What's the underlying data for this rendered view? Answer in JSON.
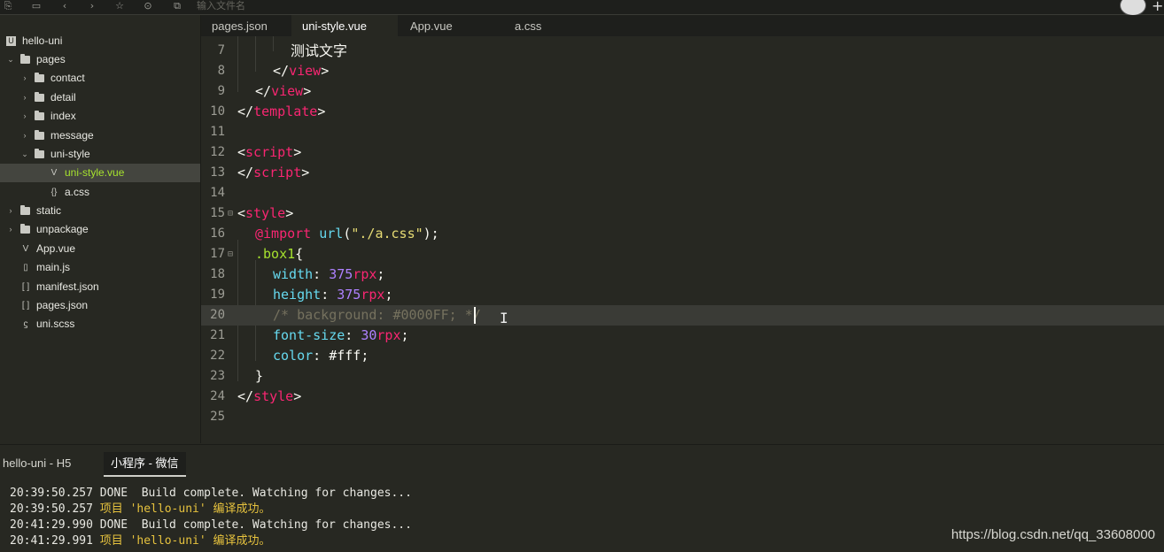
{
  "topbar": {
    "search_placeholder": "输入文件名"
  },
  "sidebar": {
    "items": [
      {
        "label": "hello-uni"
      },
      {
        "label": "pages"
      },
      {
        "label": "contact"
      },
      {
        "label": "detail"
      },
      {
        "label": "index"
      },
      {
        "label": "message"
      },
      {
        "label": "uni-style"
      },
      {
        "label": "uni-style.vue"
      },
      {
        "label": "a.css"
      },
      {
        "label": "static"
      },
      {
        "label": "unpackage"
      },
      {
        "label": "App.vue"
      },
      {
        "label": "main.js"
      },
      {
        "label": "manifest.json"
      },
      {
        "label": "pages.json"
      },
      {
        "label": "uni.scss"
      }
    ]
  },
  "tabs": [
    {
      "label": "pages.json"
    },
    {
      "label": "uni-style.vue"
    },
    {
      "label": "App.vue"
    },
    {
      "label": "a.css"
    }
  ],
  "editor": {
    "line_numbers": [
      "7",
      "8",
      "9",
      "10",
      "11",
      "12",
      "13",
      "14",
      "15",
      "16",
      "17",
      "18",
      "19",
      "20",
      "21",
      "22",
      "23",
      "24",
      "25"
    ],
    "l7": "测试文字",
    "l8": {
      "open": "</",
      "name": "view",
      "close": ">"
    },
    "l9": {
      "open": "</",
      "name": "view",
      "close": ">"
    },
    "l10": {
      "open": "</",
      "name": "template",
      "close": ">"
    },
    "l12": {
      "open": "<",
      "name": "script",
      "close": ">"
    },
    "l13": {
      "open": "</",
      "name": "script",
      "close": ">"
    },
    "l15": {
      "open": "<",
      "name": "style",
      "close": ">"
    },
    "l16": {
      "kw": "@import",
      "sp": " ",
      "fn": "url",
      "p1": "(",
      "str": "\"./a.css\"",
      "p2": ");"
    },
    "l17": {
      "sel": ".box1",
      "brace": "{"
    },
    "l18": {
      "prop": "width",
      "colon": ": ",
      "num": "375",
      "unit": "rpx",
      "semi": ";"
    },
    "l19": {
      "prop": "height",
      "colon": ": ",
      "num": "375",
      "unit": "rpx",
      "semi": ";"
    },
    "l20": {
      "comment_a": "/* background: #0000FF;",
      "comment_b": " */"
    },
    "l21": {
      "prop": "font-size",
      "colon": ": ",
      "num": "30",
      "unit": "rpx",
      "semi": ";"
    },
    "l22": {
      "prop": "color",
      "colon": ": ",
      "val": "#fff;"
    },
    "l23": "}",
    "l24": {
      "open": "</",
      "name": "style",
      "close": ">"
    }
  },
  "panel": {
    "tabs": [
      {
        "label": "hello-uni - H5"
      },
      {
        "label": "小程序 - 微信"
      }
    ],
    "lines": [
      {
        "time": "20:39:50.257",
        "msg": " DONE  Build complete. Watching for changes...",
        "ok": false
      },
      {
        "time": "20:39:50.257",
        "msg": " 项目 'hello-uni' 编译成功。",
        "ok": true
      },
      {
        "time": "20:41:29.990",
        "msg": " DONE  Build complete. Watching for changes...",
        "ok": false
      },
      {
        "time": "20:41:29.991",
        "msg": " 项目 'hello-uni' 编译成功。",
        "ok": true
      }
    ]
  },
  "watermark": "https://blog.csdn.net/qq_33608000",
  "colors": {
    "background": "#272822",
    "tag": "#f92672",
    "string": "#e6db74",
    "selector": "#a6e22e",
    "property": "#66d9ef",
    "number": "#ae81ff",
    "comment": "#75715e"
  }
}
